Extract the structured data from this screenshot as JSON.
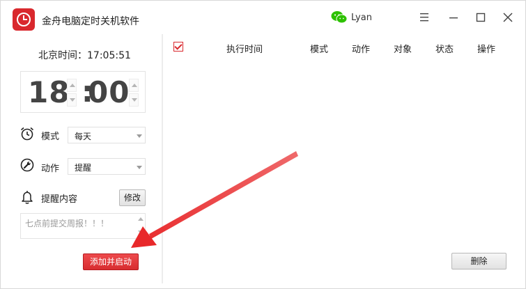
{
  "app": {
    "title": "金舟电脑定时关机软件",
    "user_name": "Lyan"
  },
  "clock": {
    "label": "北京时间：",
    "time": "17:05:51"
  },
  "time_picker": {
    "hour": "18",
    "separator": ":",
    "minute": "00"
  },
  "mode": {
    "label": "模式",
    "value": "每天"
  },
  "action": {
    "label": "动作",
    "value": "提醒"
  },
  "reminder": {
    "label": "提醒内容",
    "edit_label": "修改",
    "text": "七点前提交周报！！！"
  },
  "add_button_label": "添加并启动",
  "table": {
    "columns": [
      "执行时间",
      "模式",
      "动作",
      "对象",
      "状态",
      "操作"
    ]
  },
  "delete_button_label": "删除",
  "colors": {
    "accent": "#d9282d",
    "arrow": "#e8282a",
    "wechat": "#2dc100"
  },
  "icons": {
    "app_logo": "alarm-clock-icon",
    "wechat": "wechat-icon",
    "menu": "hamburger-menu-icon",
    "minimize": "minimize-icon",
    "maximize": "maximize-icon",
    "close": "close-icon",
    "mode": "alarm-clock-icon",
    "action": "wrench-icon",
    "reminder": "bell-icon"
  }
}
